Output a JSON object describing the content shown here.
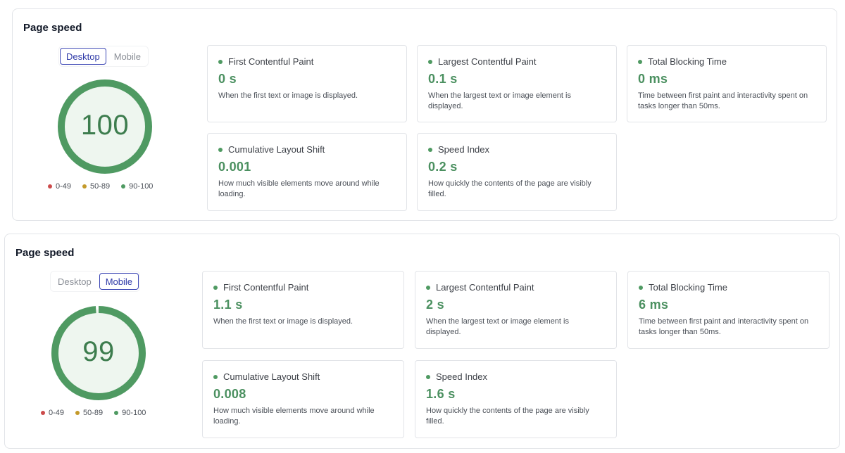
{
  "panels": [
    {
      "title": "Page speed",
      "tabs": [
        {
          "label": "Desktop",
          "active": true
        },
        {
          "label": "Mobile",
          "active": false
        }
      ],
      "score": "100",
      "score_fraction": 1.0,
      "legend": [
        {
          "label": "0-49",
          "color": "#cc4b4b"
        },
        {
          "label": "50-89",
          "color": "#c49a2a"
        },
        {
          "label": "90-100",
          "color": "#4f9a62"
        }
      ],
      "metrics": [
        {
          "label": "First Contentful Paint",
          "value": "0 s",
          "desc": "When the first text or image is displayed."
        },
        {
          "label": "Largest Contentful Paint",
          "value": "0.1 s",
          "desc": "When the largest text or image element is displayed."
        },
        {
          "label": "Total Blocking Time",
          "value": "0 ms",
          "desc": "Time between first paint and interactivity spent on tasks longer than 50ms."
        },
        {
          "label": "Cumulative Layout Shift",
          "value": "0.001",
          "desc": "How much visible elements move around while loading."
        },
        {
          "label": "Speed Index",
          "value": "0.2 s",
          "desc": "How quickly the contents of the page are visibly filled."
        }
      ]
    },
    {
      "title": "Page speed",
      "tabs": [
        {
          "label": "Desktop",
          "active": false
        },
        {
          "label": "Mobile",
          "active": true
        }
      ],
      "score": "99",
      "score_fraction": 0.99,
      "legend": [
        {
          "label": "0-49",
          "color": "#cc4b4b"
        },
        {
          "label": "50-89",
          "color": "#c49a2a"
        },
        {
          "label": "90-100",
          "color": "#4f9a62"
        }
      ],
      "metrics": [
        {
          "label": "First Contentful Paint",
          "value": "1.1 s",
          "desc": "When the first text or image is displayed."
        },
        {
          "label": "Largest Contentful Paint",
          "value": "2 s",
          "desc": "When the largest text or image element is displayed."
        },
        {
          "label": "Total Blocking Time",
          "value": "6 ms",
          "desc": "Time between first paint and interactivity spent on tasks longer than 50ms."
        },
        {
          "label": "Cumulative Layout Shift",
          "value": "0.008",
          "desc": "How much visible elements move around while loading."
        },
        {
          "label": "Speed Index",
          "value": "1.6 s",
          "desc": "How quickly the contents of the page are visibly filled."
        }
      ]
    }
  ],
  "colors": {
    "good": "#4f9a62",
    "gauge_fill": "#eef6ef",
    "accent": "#3d47b5"
  }
}
